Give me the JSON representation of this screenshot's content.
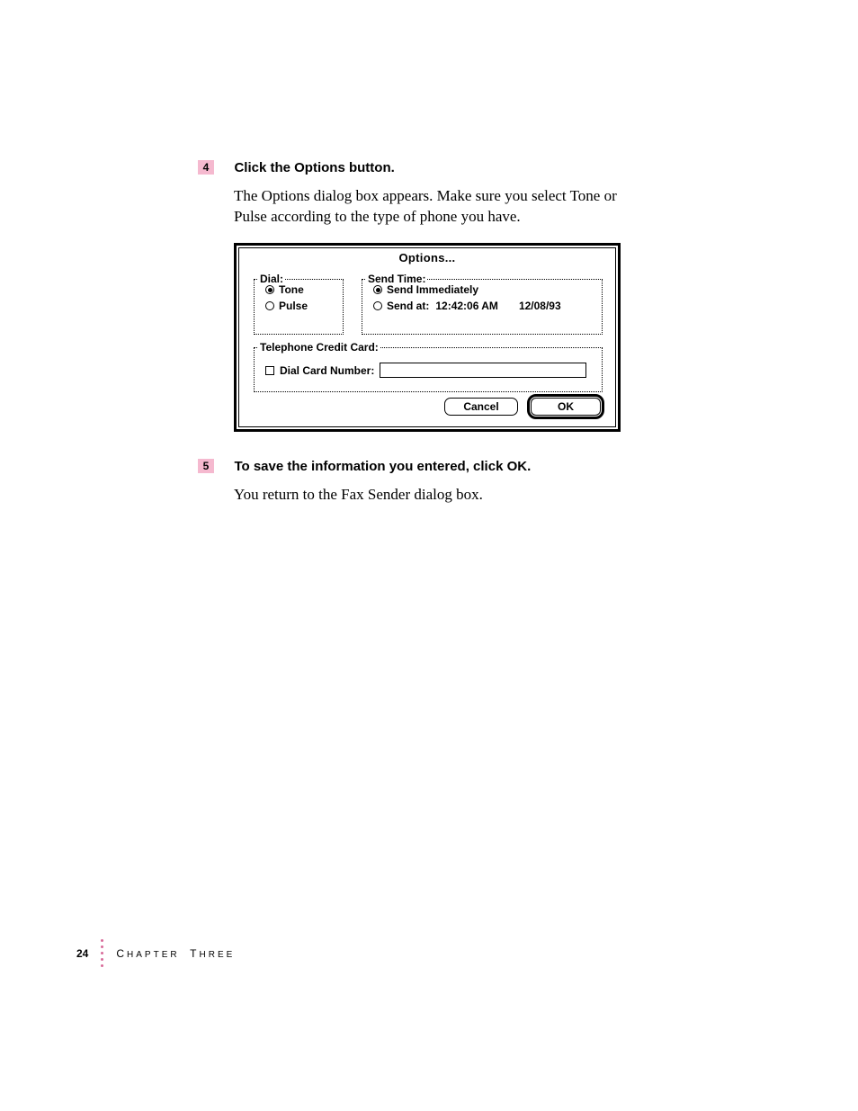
{
  "step4": {
    "num": "4",
    "title": "Click the Options button.",
    "body": "The Options dialog box appears. Make sure you select Tone or Pulse according to the type of phone you have."
  },
  "dialog": {
    "title": "Options...",
    "dial": {
      "label": "Dial:",
      "tone": "Tone",
      "pulse": "Pulse"
    },
    "sendtime": {
      "label": "Send Time:",
      "immediate": "Send Immediately",
      "sendat_prefix": "Send at:",
      "sendat_time": "12:42:06 AM",
      "sendat_date": "12/08/93"
    },
    "cc": {
      "label": "Telephone Credit Card:",
      "check_label": "Dial Card Number:"
    },
    "buttons": {
      "cancel": "Cancel",
      "ok": "OK"
    }
  },
  "step5": {
    "num": "5",
    "title": "To save the information you entered, click OK.",
    "body": "You return to the Fax Sender dialog box."
  },
  "footer": {
    "page": "24",
    "chapter_word": "HAPTER",
    "chapter_initial": "C",
    "three_initial": "T",
    "three_word": "HREE"
  }
}
